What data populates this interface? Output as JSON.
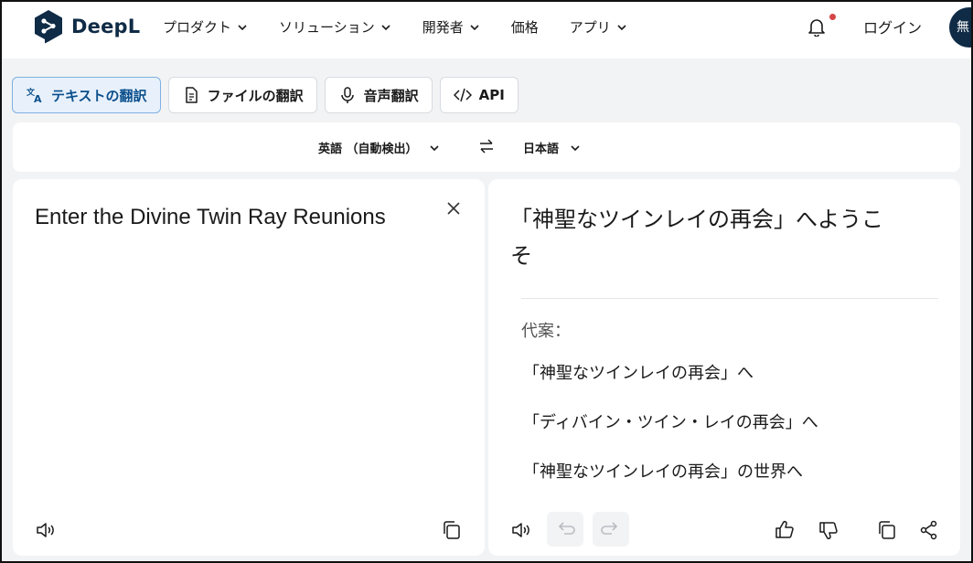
{
  "header": {
    "brand": "DeepL",
    "nav": [
      {
        "label": "プロダクト",
        "has_dropdown": true
      },
      {
        "label": "ソリューション",
        "has_dropdown": true
      },
      {
        "label": "開発者",
        "has_dropdown": true
      },
      {
        "label": "価格",
        "has_dropdown": false
      },
      {
        "label": "アプリ",
        "has_dropdown": true
      }
    ],
    "login": "ログイン",
    "avatar_text": "無"
  },
  "tabs": [
    {
      "label": "テキストの翻訳",
      "icon": "translate-icon",
      "active": true
    },
    {
      "label": "ファイルの翻訳",
      "icon": "document-icon",
      "active": false
    },
    {
      "label": "音声翻訳",
      "icon": "microphone-icon",
      "active": false
    },
    {
      "label": "API",
      "icon": "code-icon",
      "active": false
    }
  ],
  "languages": {
    "source": "英語 （自動検出）",
    "target": "日本語"
  },
  "source_panel": {
    "text": "Enter the Divine Twin Ray Reunions"
  },
  "target_panel": {
    "text": "「神聖なツインレイの再会」へようこそ",
    "alternatives_label": "代案：",
    "alternatives": [
      "「神聖なツインレイの再会」へ",
      "「ディバイン・ツイン・レイの再会」へ",
      "「神聖なツインレイの再会」の世界へ"
    ]
  },
  "colors": {
    "brand": "#0f2b46",
    "active_tab_bg": "#e8f1fb",
    "active_tab_border": "#7fb0e2",
    "notification_dot": "#d64545",
    "page_bg": "#f2f3f5"
  }
}
